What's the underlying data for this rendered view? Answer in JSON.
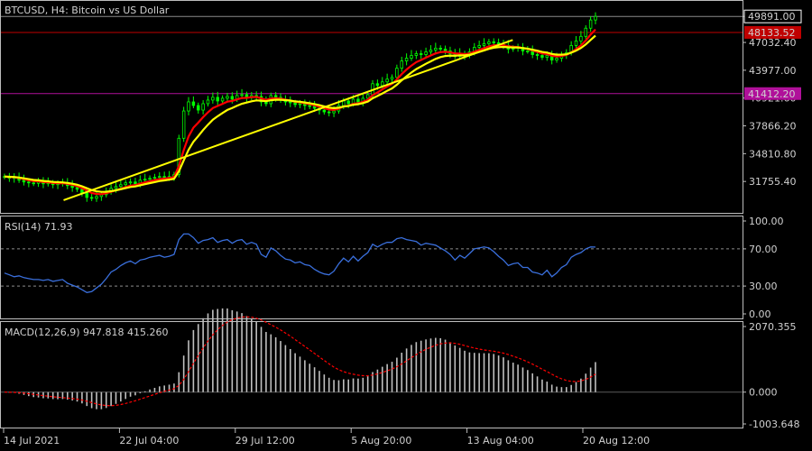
{
  "chart_data": [
    {
      "type": "candlestick",
      "title": "BTCUSD, H4:  Bitcoin vs US Dollar",
      "price_ticks": [
        "49891.00",
        "47032.40",
        "43977.00",
        "40921.60",
        "37866.20",
        "34810.80",
        "31755.40"
      ],
      "price_ticks_values": [
        49891.0,
        47032.4,
        43977.0,
        40921.6,
        37866.2,
        34810.8,
        31755.4
      ],
      "ylim": [
        28700,
        51300
      ],
      "current_price": {
        "label": "49891.00",
        "value": 49891.0,
        "color": "#ffffff"
      },
      "horizontal_levels": [
        {
          "label": "48133.52",
          "value": 48133.52,
          "color": "#c00000"
        },
        {
          "label": "41412.20",
          "value": 41412.2,
          "color": "#b0109a"
        }
      ],
      "moving_averages": [
        {
          "color": "#ff0000"
        },
        {
          "color": "#ffff00"
        }
      ],
      "trendline": {
        "color": "#ffff00",
        "from": [
          0.1,
          29700
        ],
        "to": [
          0.86,
          47300
        ]
      },
      "x_ticks": [
        "14 Jul 2021",
        "22 Jul 04:00",
        "29 Jul 12:00",
        "5 Aug 20:00",
        "13 Aug 04:00",
        "20 Aug 12:00"
      ],
      "x_ticks_positions": [
        0.0,
        0.2,
        0.4,
        0.6,
        0.8,
        1.0
      ],
      "candle_color": "#00ff00",
      "closes": [
        32300,
        32100,
        32200,
        31900,
        31700,
        31600,
        31550,
        31700,
        31500,
        31600,
        31400,
        31500,
        31600,
        31300,
        31100,
        30900,
        30500,
        30000,
        29900,
        30100,
        30300,
        30700,
        31000,
        31200,
        31400,
        31600,
        31700,
        31500,
        31900,
        32000,
        32100,
        32200,
        32300,
        32200,
        32300,
        32500,
        36500,
        39500,
        40500,
        40100,
        39600,
        40300,
        40700,
        41000,
        40600,
        40900,
        41100,
        40800,
        41200,
        41300,
        41000,
        41200,
        41100,
        40500,
        40300,
        41200,
        41000,
        40700,
        40500,
        40400,
        40200,
        40300,
        40100,
        40000,
        39800,
        39600,
        39400,
        39300,
        39500,
        40100,
        40600,
        40300,
        40800,
        40500,
        40900,
        41300,
        42500,
        42300,
        42700,
        43000,
        43200,
        44200,
        45000,
        45300,
        45600,
        45800,
        45700,
        46000,
        46200,
        46400,
        46300,
        46100,
        45800,
        45500,
        45800,
        45600,
        46000,
        46500,
        46700,
        46900,
        47100,
        47000,
        46800,
        46700,
        46300,
        46400,
        46500,
        46100,
        46100,
        45700,
        45600,
        45400,
        45600,
        45100,
        45300,
        45700,
        45900,
        46700,
        47200,
        47700,
        48600,
        49500,
        49891
      ],
      "rsi_panel": {
        "label": "RSI(14) 71.93",
        "value": 71.93,
        "ticks": [
          "100.00",
          "70.00",
          "30.00",
          "0.00"
        ],
        "ticks_values": [
          100,
          70,
          30,
          0
        ],
        "levels": [
          70,
          30
        ],
        "color": "#3a6fdc",
        "values": [
          44,
          42,
          40,
          41,
          39,
          38,
          37,
          37,
          36,
          37,
          35,
          36,
          37,
          33,
          31,
          29,
          26,
          23,
          24,
          28,
          32,
          38,
          45,
          48,
          52,
          55,
          57,
          54,
          58,
          59,
          61,
          62,
          63,
          61,
          62,
          64,
          80,
          86,
          86,
          82,
          76,
          79,
          80,
          82,
          77,
          79,
          80,
          76,
          79,
          80,
          75,
          77,
          75,
          64,
          61,
          71,
          68,
          63,
          59,
          58,
          55,
          56,
          53,
          52,
          48,
          45,
          43,
          42,
          46,
          54,
          60,
          56,
          62,
          57,
          62,
          66,
          75,
          72,
          75,
          77,
          77,
          81,
          82,
          80,
          79,
          78,
          74,
          76,
          75,
          74,
          71,
          68,
          64,
          58,
          63,
          60,
          65,
          70,
          71,
          72,
          71,
          67,
          62,
          58,
          52,
          54,
          55,
          50,
          50,
          45,
          44,
          42,
          47,
          40,
          44,
          50,
          53,
          61,
          64,
          66,
          70,
          72,
          71.93
        ]
      },
      "macd_panel": {
        "label": "MACD(12,26,9) 947.818 415.260",
        "macd_value": 947.818,
        "signal_value": 415.26,
        "ticks": [
          "2070.355",
          "0.000",
          "-1003.648"
        ],
        "ticks_values": [
          2070.355,
          0,
          -1003.648
        ],
        "ylim": [
          -1003.648,
          2070.355
        ],
        "histogram_color": "#c0c0c0",
        "signal_color": "#ff0000"
      }
    }
  ]
}
